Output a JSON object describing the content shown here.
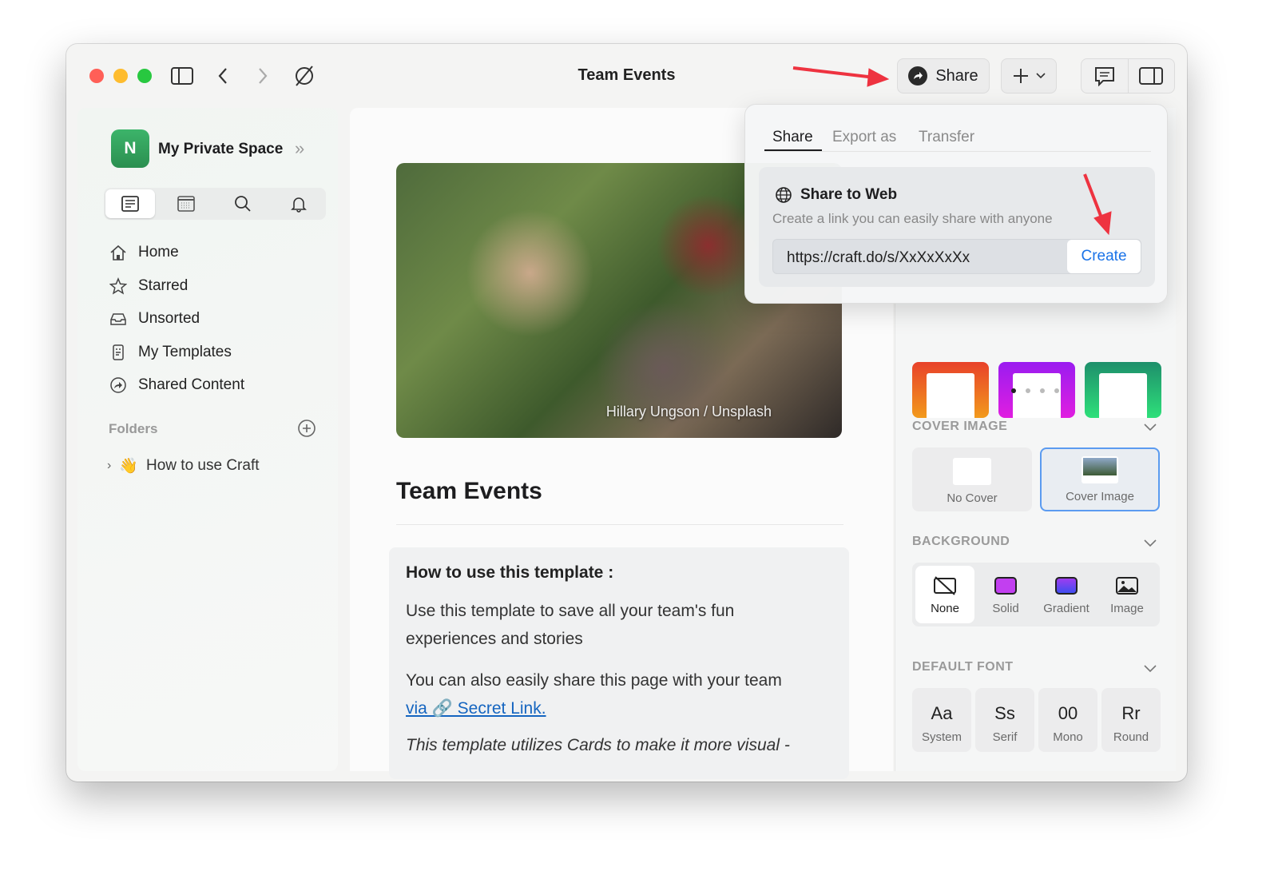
{
  "window": {
    "title": "Team Events"
  },
  "toolbar": {
    "share_label": "Share",
    "icons": [
      "sidebar-toggle-icon",
      "back-icon",
      "forward-icon",
      "sync-off-icon",
      "share-icon",
      "plus-icon",
      "chevron-down-icon",
      "comment-icon",
      "inspector-icon"
    ]
  },
  "sidebar": {
    "space_initial": "N",
    "space_name": "My Private Space",
    "nav": [
      {
        "label": "Home",
        "icon": "home-icon"
      },
      {
        "label": "Starred",
        "icon": "star-icon"
      },
      {
        "label": "Unsorted",
        "icon": "inbox-icon"
      },
      {
        "label": "My Templates",
        "icon": "template-icon"
      },
      {
        "label": "Shared Content",
        "icon": "shared-icon"
      }
    ],
    "folders_label": "Folders",
    "folders": [
      {
        "emoji": "👋",
        "label": "How to use Craft"
      }
    ]
  },
  "document": {
    "image_credit": "Hillary Ungson / Unsplash",
    "title": "Team Events",
    "card_heading": "How to use this template :",
    "para1": "Use this template to save all your team's fun experiences and stories",
    "para2": "You can also easily share this page with your team",
    "link_text": "via 🔗 Secret Link.",
    "para3": "This template utilizes Cards to make it more visual -"
  },
  "share_popover": {
    "tabs": [
      "Share",
      "Export as",
      "Transfer"
    ],
    "active_tab": "Share",
    "heading": "Share to Web",
    "description": "Create a link you can easily share with anyone",
    "url": "https://craft.do/s/XxXxXxXx",
    "create_label": "Create"
  },
  "panel": {
    "theme_colors": [
      "#e8412a",
      "#a81cf0",
      "#1ea36b"
    ],
    "page_dots": 4,
    "active_dot": 1,
    "cover_label": "COVER IMAGE",
    "cover_options": [
      "No Cover",
      "Cover Image"
    ],
    "cover_selected": "Cover Image",
    "background_label": "BACKGROUND",
    "background_options": [
      "None",
      "Solid",
      "Gradient",
      "Image"
    ],
    "background_selected": "None",
    "font_label": "DEFAULT FONT",
    "fonts": [
      {
        "glyph": "Aa",
        "label": "System"
      },
      {
        "glyph": "Ss",
        "label": "Serif"
      },
      {
        "glyph": "00",
        "label": "Mono"
      },
      {
        "glyph": "Rr",
        "label": "Round"
      }
    ]
  },
  "colors": {
    "accent": "#1a73e8",
    "link": "#1565c0",
    "annotation_arrow": "#ee3340"
  }
}
